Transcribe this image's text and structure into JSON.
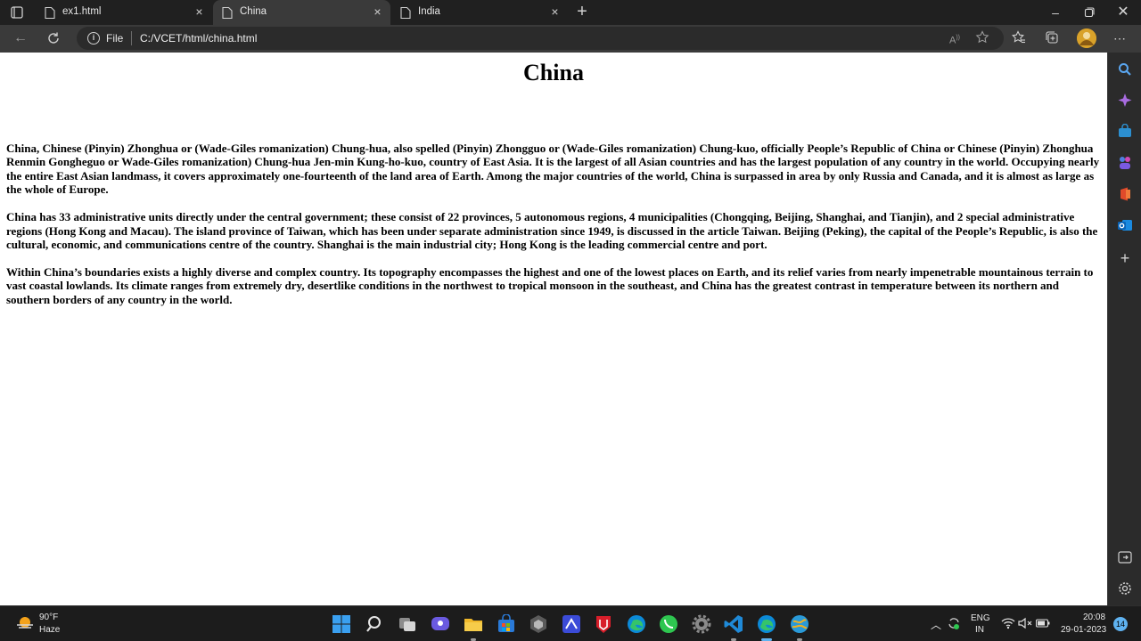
{
  "browser": {
    "tabs": [
      {
        "label": "ex1.html",
        "active": false
      },
      {
        "label": "China",
        "active": true
      },
      {
        "label": "India",
        "active": false
      }
    ],
    "address": {
      "scheme_label": "File",
      "url": "C:/VCET/html/china.html"
    }
  },
  "page": {
    "heading": "China",
    "paragraphs": [
      "China, Chinese (Pinyin) Zhonghua or (Wade-Giles romanization) Chung-hua, also spelled (Pinyin) Zhongguo or (Wade-Giles romanization) Chung-kuo, officially People’s Republic of China or Chinese (Pinyin) Zhonghua Renmin Gongheguo or Wade-Giles romanization) Chung-hua Jen-min Kung-ho-kuo, country of East Asia. It is the largest of all Asian countries and has the largest population of any country in the world. Occupying nearly the entire East Asian landmass, it covers approximately one-fourteenth of the land area of Earth. Among the major countries of the world, China is surpassed in area by only Russia and Canada, and it is almost as large as the whole of Europe.",
      "China has 33 administrative units directly under the central government; these consist of 22 provinces, 5 autonomous regions, 4 municipalities (Chongqing, Beijing, Shanghai, and Tianjin), and 2 special administrative regions (Hong Kong and Macau). The island province of Taiwan, which has been under separate administration since 1949, is discussed in the article Taiwan. Beijing (Peking), the capital of the People’s Republic, is also the cultural, economic, and communications centre of the country. Shanghai is the main industrial city; Hong Kong is the leading commercial centre and port.",
      "Within China’s boundaries exists a highly diverse and complex country. Its topography encompasses the highest and one of the lowest places on Earth, and its relief varies from nearly impenetrable mountainous terrain to vast coastal lowlands. Its climate ranges from extremely dry, desertlike conditions in the northwest to tropical monsoon in the southeast, and China has the greatest contrast in temperature between its northern and southern borders of any country in the world."
    ]
  },
  "taskbar": {
    "weather": {
      "temp": "90°F",
      "desc": "Haze",
      "icon": "weather-sun-haze-icon"
    },
    "apps": [
      "start-icon",
      "search-icon",
      "task-view-icon",
      "chat-icon",
      "file-explorer-icon",
      "store-icon",
      "app-icon",
      "powerapps-icon",
      "mcafee-icon",
      "edge-icon",
      "whatsapp-icon",
      "settings-icon",
      "vscode-icon",
      "edge-active-icon",
      "browser-icon"
    ],
    "tray": {
      "lang_top": "ENG",
      "lang_bottom": "IN",
      "time": "20:08",
      "date": "29-01-2023",
      "notifications": "14"
    }
  },
  "colors": {
    "accent": "#5fb2f0",
    "chrome_dark": "#202020",
    "toolbar": "#3a3a3a"
  }
}
